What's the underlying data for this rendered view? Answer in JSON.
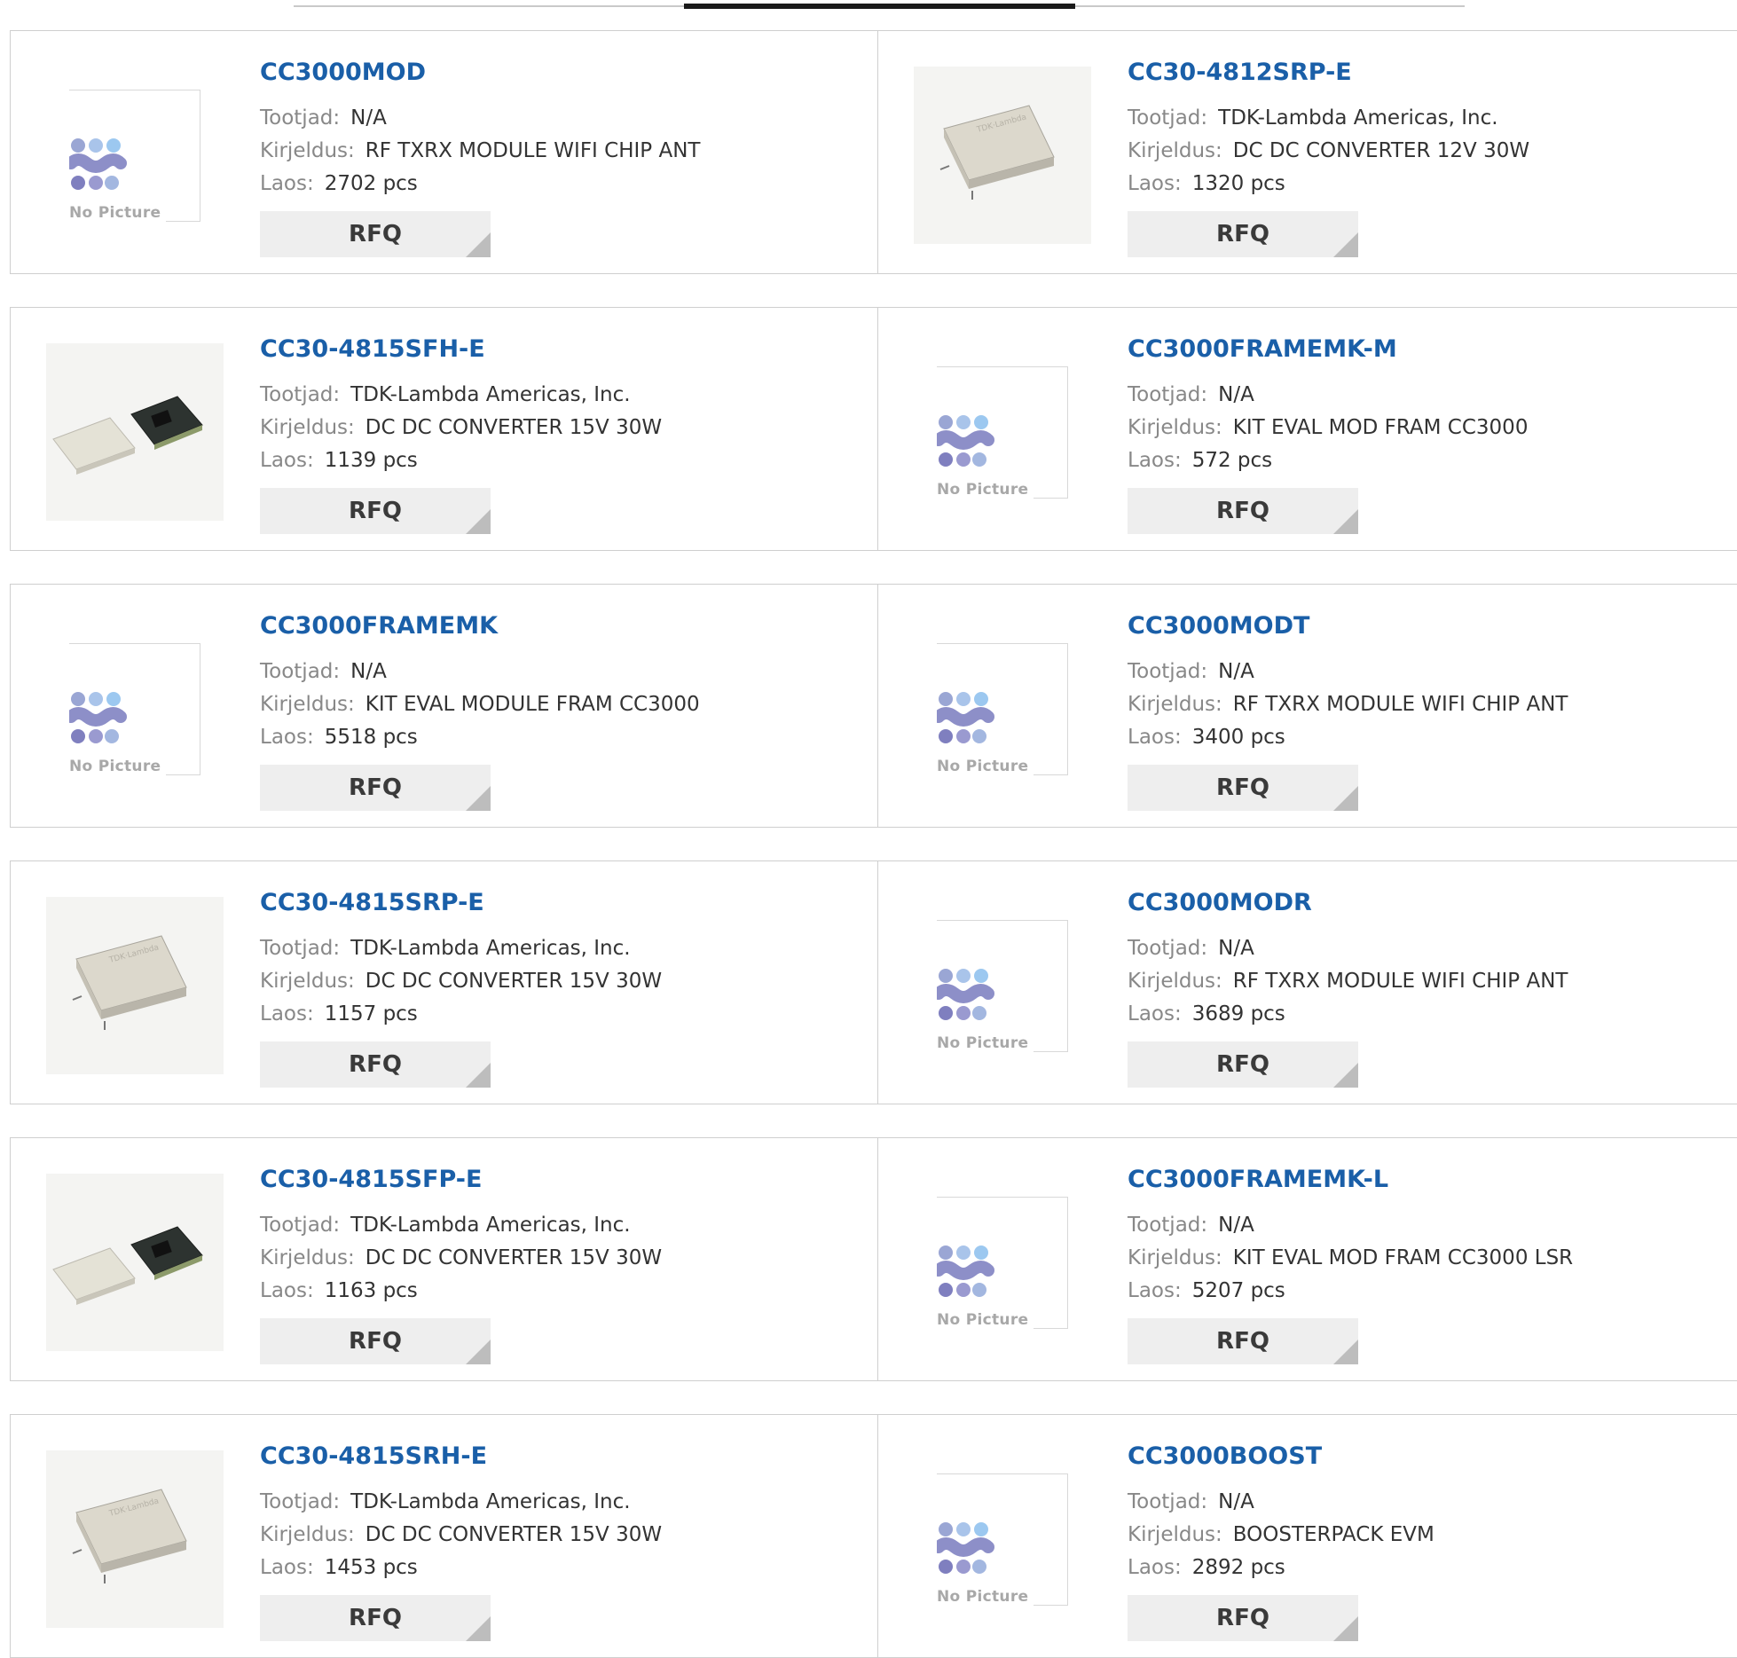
{
  "labels": {
    "manufacturer": "Tootjad:",
    "description": "Kirjeldus:",
    "stock": "Laos:",
    "rfq": "RFQ",
    "no_picture": "No Picture"
  },
  "products": [
    {
      "part": "CC3000MOD",
      "manufacturer": "N/A",
      "description": "RF TXRX MODULE WIFI CHIP ANT",
      "stock": "2702 pcs",
      "image": "no-picture"
    },
    {
      "part": "CC30-4812SRP-E",
      "manufacturer": "TDK-Lambda Americas, Inc.",
      "description": "DC DC CONVERTER 12V 30W",
      "stock": "1320 pcs",
      "image": "module"
    },
    {
      "part": "CC30-4815SFH-E",
      "manufacturer": "TDK-Lambda Americas, Inc.",
      "description": "DC DC CONVERTER 15V 30W",
      "stock": "1139 pcs",
      "image": "module-pair"
    },
    {
      "part": "CC3000FRAMEMK-M",
      "manufacturer": "N/A",
      "description": "KIT EVAL MOD FRAM CC3000",
      "stock": "572 pcs",
      "image": "no-picture"
    },
    {
      "part": "CC3000FRAMEMK",
      "manufacturer": "N/A",
      "description": "KIT EVAL MODULE FRAM CC3000",
      "stock": "5518 pcs",
      "image": "no-picture"
    },
    {
      "part": "CC3000MODT",
      "manufacturer": "N/A",
      "description": "RF TXRX MODULE WIFI CHIP ANT",
      "stock": "3400 pcs",
      "image": "no-picture"
    },
    {
      "part": "CC30-4815SRP-E",
      "manufacturer": "TDK-Lambda Americas, Inc.",
      "description": "DC DC CONVERTER 15V 30W",
      "stock": "1157 pcs",
      "image": "module"
    },
    {
      "part": "CC3000MODR",
      "manufacturer": "N/A",
      "description": "RF TXRX MODULE WIFI CHIP ANT",
      "stock": "3689 pcs",
      "image": "no-picture"
    },
    {
      "part": "CC30-4815SFP-E",
      "manufacturer": "TDK-Lambda Americas, Inc.",
      "description": "DC DC CONVERTER 15V 30W",
      "stock": "1163 pcs",
      "image": "module-pair"
    },
    {
      "part": "CC3000FRAMEMK-L",
      "manufacturer": "N/A",
      "description": "KIT EVAL MOD FRAM CC3000 LSR",
      "stock": "5207 pcs",
      "image": "no-picture"
    },
    {
      "part": "CC30-4815SRH-E",
      "manufacturer": "TDK-Lambda Americas, Inc.",
      "description": "DC DC CONVERTER 15V 30W",
      "stock": "1453 pcs",
      "image": "module"
    },
    {
      "part": "CC3000BOOST",
      "manufacturer": "N/A",
      "description": "BOOSTERPACK EVM",
      "stock": "2892 pcs",
      "image": "no-picture"
    }
  ]
}
